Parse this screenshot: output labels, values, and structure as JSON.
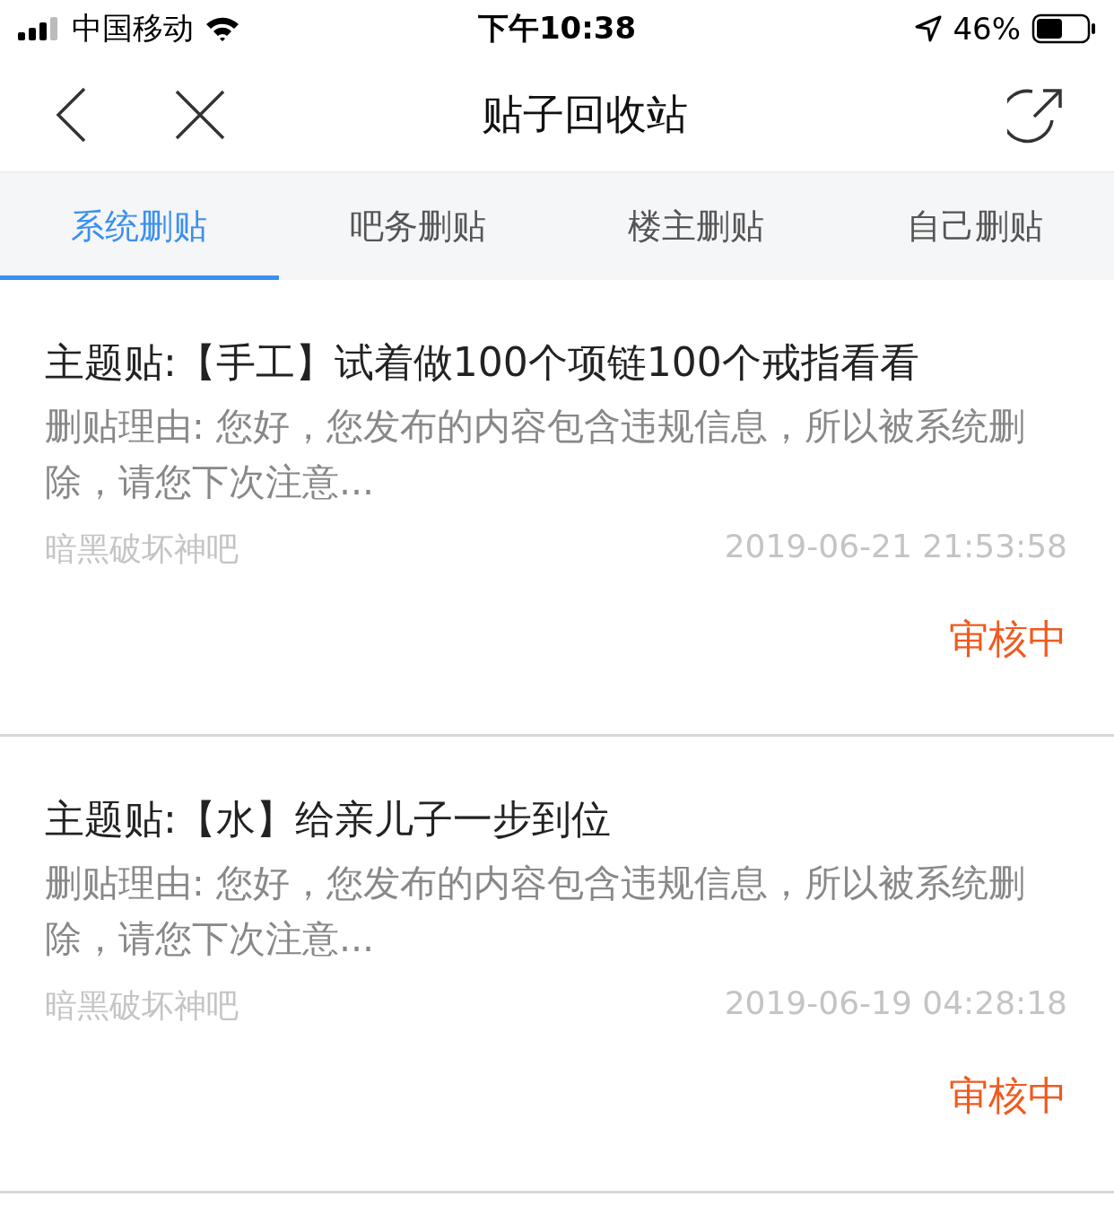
{
  "status_bar": {
    "carrier": "中国移动",
    "time": "下午10:38",
    "battery": "46%"
  },
  "nav": {
    "title": "贴子回收站"
  },
  "tabs": [
    {
      "label": "系统删贴",
      "selected": true
    },
    {
      "label": "吧务删贴",
      "selected": false
    },
    {
      "label": "楼主删贴",
      "selected": false
    },
    {
      "label": "自己删贴",
      "selected": false
    }
  ],
  "posts": [
    {
      "title": "主题贴:【手工】试着做100个项链100个戒指看看",
      "reason": "删贴理由: 您好，您发布的内容包含违规信息，所以被系统删除，请您下次注意...",
      "forum": "暗黑破坏神吧",
      "time": "2019-06-21 21:53:58",
      "status": "审核中"
    },
    {
      "title": "主题贴:【水】给亲儿子一步到位",
      "reason": "删贴理由: 您好，您发布的内容包含违规信息，所以被系统删除，请您下次注意...",
      "forum": "暗黑破坏神吧",
      "time": "2019-06-19 04:28:18",
      "status": "审核中"
    }
  ]
}
